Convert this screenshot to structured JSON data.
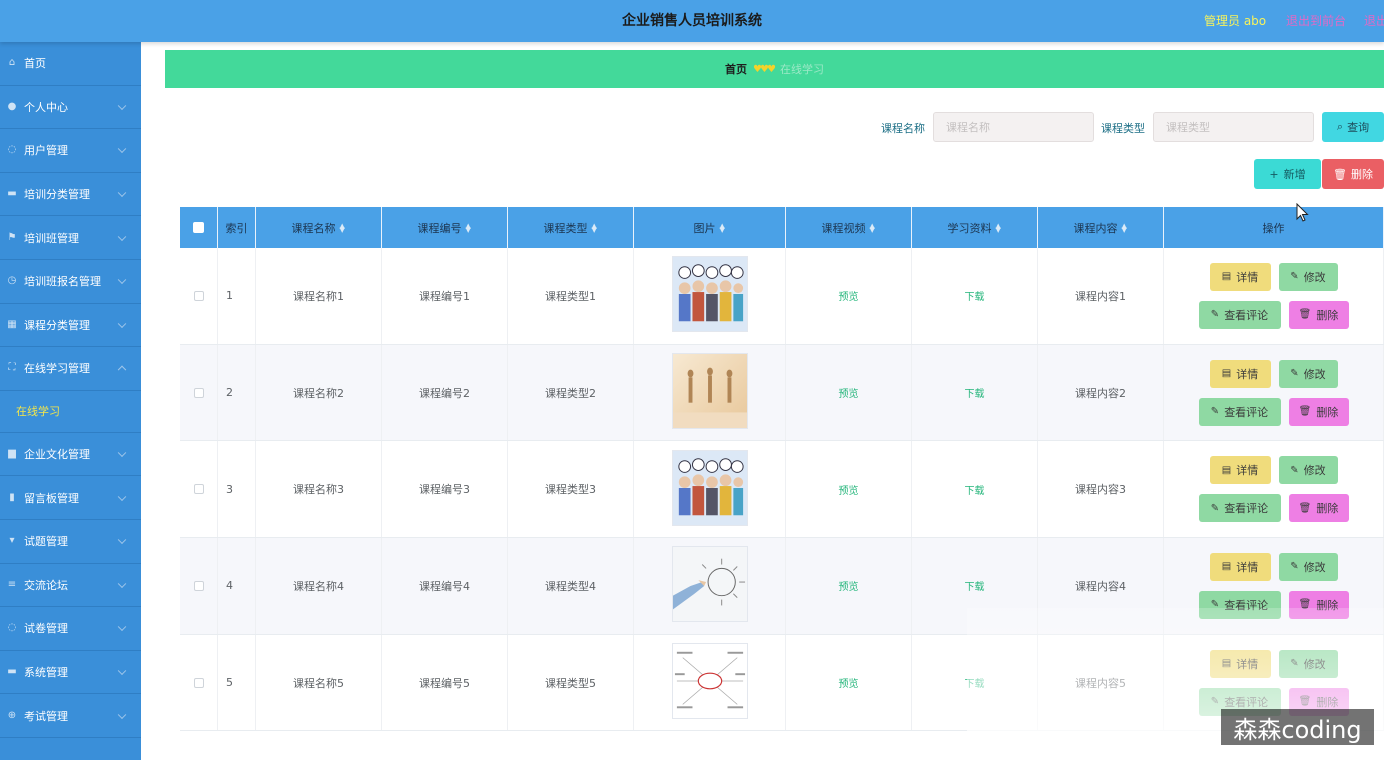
{
  "header": {
    "title": "企业销售人员培训系统",
    "admin": "管理员 abo",
    "front": "退出到前台",
    "logout": "退出登录"
  },
  "sidebar": {
    "items": [
      {
        "label": "首页",
        "icon": "home-icon",
        "chevron": false
      },
      {
        "label": "个人中心",
        "icon": "user-icon",
        "chevron": true
      },
      {
        "label": "用户管理",
        "icon": "location-icon",
        "chevron": true
      },
      {
        "label": "培训分类管理",
        "icon": "briefcase-icon",
        "chevron": true
      },
      {
        "label": "培训班管理",
        "icon": "flag-icon",
        "chevron": true
      },
      {
        "label": "培训班报名管理",
        "icon": "clock-icon",
        "chevron": true
      },
      {
        "label": "课程分类管理",
        "icon": "grid-icon",
        "chevron": true
      },
      {
        "label": "在线学习管理",
        "icon": "fullscreen-icon",
        "chevron": true,
        "expanded": true
      }
    ],
    "submenu": {
      "label": "在线学习"
    },
    "items2": [
      {
        "label": "企业文化管理",
        "icon": "building-icon"
      },
      {
        "label": "留言板管理",
        "icon": "chart-icon"
      },
      {
        "label": "试题管理",
        "icon": "trophy-icon"
      },
      {
        "label": "交流论坛",
        "icon": "forum-icon"
      },
      {
        "label": "试卷管理",
        "icon": "bulb-icon"
      },
      {
        "label": "系统管理",
        "icon": "chat-icon"
      },
      {
        "label": "考试管理",
        "icon": "plus-circle-icon"
      }
    ]
  },
  "breadcrumb": {
    "home": "首页",
    "current": "在线学习"
  },
  "search": {
    "name_label": "课程名称",
    "name_placeholder": "课程名称",
    "type_label": "课程类型",
    "type_placeholder": "课程类型",
    "query_label": "查询"
  },
  "actions": {
    "add_label": "新增",
    "delete_label": "删除"
  },
  "table": {
    "headers": [
      "索引",
      "课程名称",
      "课程编号",
      "课程类型",
      "图片",
      "课程视频",
      "学习资料",
      "课程内容",
      "操作"
    ],
    "rows": [
      {
        "index": "1",
        "name": "课程名称1",
        "code": "课程编号1",
        "type": "课程类型1",
        "video": "预览",
        "material": "下载",
        "content": "课程内容1"
      },
      {
        "index": "2",
        "name": "课程名称2",
        "code": "课程编号2",
        "type": "课程类型2",
        "video": "预览",
        "material": "下载",
        "content": "课程内容2"
      },
      {
        "index": "3",
        "name": "课程名称3",
        "code": "课程编号3",
        "type": "课程类型3",
        "video": "预览",
        "material": "下载",
        "content": "课程内容3"
      },
      {
        "index": "4",
        "name": "课程名称4",
        "code": "课程编号4",
        "type": "课程类型4",
        "video": "预览",
        "material": "下载",
        "content": "课程内容4"
      },
      {
        "index": "5",
        "name": "课程名称5",
        "code": "课程编号5",
        "type": "课程类型5",
        "video": "预览",
        "material": "下载",
        "content": "课程内容5"
      }
    ],
    "ops": {
      "detail": "详情",
      "edit": "修改",
      "comment": "查看评论",
      "remove": "删除"
    }
  },
  "watermark": "森森coding",
  "colors": {
    "topbar": "#4aa1e7",
    "sidebar": "#3a8fd9",
    "breadcrumb": "#43d99a",
    "accent_yellow": "#f2e64b"
  }
}
